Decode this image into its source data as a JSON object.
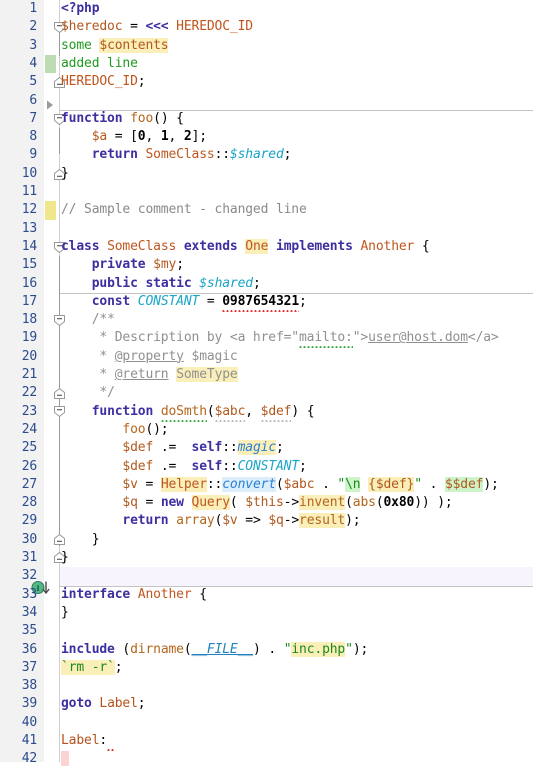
{
  "editor": {
    "language": "PHP",
    "font_size_px": 13,
    "line_height_px": 18.3,
    "total_lines": 42,
    "gutter_bg": "#f2f2f2",
    "background": "#ffffff",
    "line_number_color": "#2b4b8f",
    "caret_line": 32,
    "caret_line_bg": "#f7f4fd"
  },
  "colors": {
    "keyword": "#3c2fa0",
    "class_name": "#c0561f",
    "variable": "#b1581d",
    "string": "#1a8a1a",
    "comment": "#8a8a8a",
    "doc_comment": "#909090",
    "field": "#17a3c4",
    "constant": "#19a6c8",
    "method": "#2a7fd4",
    "number": "#000000",
    "search_highlight_tan": "#faeeb9",
    "identifier_highlight_blue": "#ddeefb",
    "escape_highlight_green": "#cdf3c9",
    "error_highlight_pink": "#fcd3d3",
    "changebar_added": "#bddcb1",
    "changebar_modified": "#f0e68c",
    "error_squiggle": "#e03030",
    "typo_squiggle": "#3fa83f"
  },
  "gutter": {
    "change_bars": [
      {
        "line": 4,
        "type": "added",
        "color": "#bddcb1"
      },
      {
        "line": 12,
        "type": "modified",
        "color": "#f0e68c"
      }
    ],
    "fold_markers": [
      {
        "line": 2,
        "state": "expanded"
      },
      {
        "line": 5,
        "state": "end"
      },
      {
        "line": 7,
        "state": "expanded"
      },
      {
        "line": 10,
        "state": "end"
      },
      {
        "line": 14,
        "state": "expanded"
      },
      {
        "line": 18,
        "state": "expanded"
      },
      {
        "line": 22,
        "state": "end"
      },
      {
        "line": 23,
        "state": "expanded"
      },
      {
        "line": 30,
        "state": "end"
      },
      {
        "line": 31,
        "state": "end"
      }
    ],
    "collapsed_region_indicator": {
      "line": 6,
      "icon": "triangle-right-icon"
    },
    "implementation_marker": {
      "line": 33,
      "icon": "implemented-by-icon",
      "color": "#4caf7d"
    }
  },
  "code_lines": [
    {
      "n": 1,
      "text": "<?php"
    },
    {
      "n": 2,
      "text": "$heredoc = <<< HEREDOC_ID"
    },
    {
      "n": 3,
      "text": "some $contents"
    },
    {
      "n": 4,
      "text": "added line"
    },
    {
      "n": 5,
      "text": "HEREDOC_ID;"
    },
    {
      "n": 6,
      "text": ""
    },
    {
      "n": 7,
      "text": "function foo() {"
    },
    {
      "n": 8,
      "text": "    $a = [0, 1, 2];"
    },
    {
      "n": 9,
      "text": "    return SomeClass::$shared;"
    },
    {
      "n": 10,
      "text": "}"
    },
    {
      "n": 11,
      "text": ""
    },
    {
      "n": 12,
      "text": "// Sample comment - changed line"
    },
    {
      "n": 13,
      "text": ""
    },
    {
      "n": 14,
      "text": "class SomeClass extends One implements Another {"
    },
    {
      "n": 15,
      "text": "    private $my;"
    },
    {
      "n": 16,
      "text": "    public static $shared;"
    },
    {
      "n": 17,
      "text": "    const CONSTANT = 0987654321;"
    },
    {
      "n": 18,
      "text": "    /**"
    },
    {
      "n": 19,
      "text": "     * Description by <a href=\"mailto:\">user@host.dom</a>"
    },
    {
      "n": 20,
      "text": "     * @property $magic"
    },
    {
      "n": 21,
      "text": "     * @return SomeType"
    },
    {
      "n": 22,
      "text": "     */"
    },
    {
      "n": 23,
      "text": "    function doSmth($abc, $def) {"
    },
    {
      "n": 24,
      "text": "        foo();"
    },
    {
      "n": 25,
      "text": "        $def .=  self::magic;"
    },
    {
      "n": 26,
      "text": "        $def .=  self::CONSTANT;"
    },
    {
      "n": 27,
      "text": "        $v = Helper::convert($abc . \"\\n {$def}\" . $$def);"
    },
    {
      "n": 28,
      "text": "        $q = new Query( $this->invent(abs(0x80)) );"
    },
    {
      "n": 29,
      "text": "        return array($v => $q->result);"
    },
    {
      "n": 30,
      "text": "    }"
    },
    {
      "n": 31,
      "text": "}"
    },
    {
      "n": 32,
      "text": ""
    },
    {
      "n": 33,
      "text": "interface Another {"
    },
    {
      "n": 34,
      "text": "}"
    },
    {
      "n": 35,
      "text": ""
    },
    {
      "n": 36,
      "text": "include (dirname(__FILE__) . \"inc.php\");"
    },
    {
      "n": 37,
      "text": "`rm -r`;"
    },
    {
      "n": 38,
      "text": ""
    },
    {
      "n": 39,
      "text": "goto Label;"
    },
    {
      "n": 40,
      "text": ""
    },
    {
      "n": 41,
      "text": "Label:"
    },
    {
      "n": 42,
      "text": ""
    }
  ],
  "annotations": {
    "highlighted_occurrences": [
      "$contents",
      "One",
      "SomeType",
      "magic",
      "Helper",
      "{$def}",
      "$$def",
      "\\n",
      "Query",
      "invent",
      "result",
      "inc.php",
      "`rm -r`"
    ],
    "error_underlines": [
      "0987654321",
      "Label:"
    ],
    "typo_underlines": [
      "doSmth",
      "mailto:",
      "$abc",
      "$def"
    ],
    "link_text": [
      "user@host.dom",
      "@property",
      "@return",
      "mailto:"
    ]
  }
}
